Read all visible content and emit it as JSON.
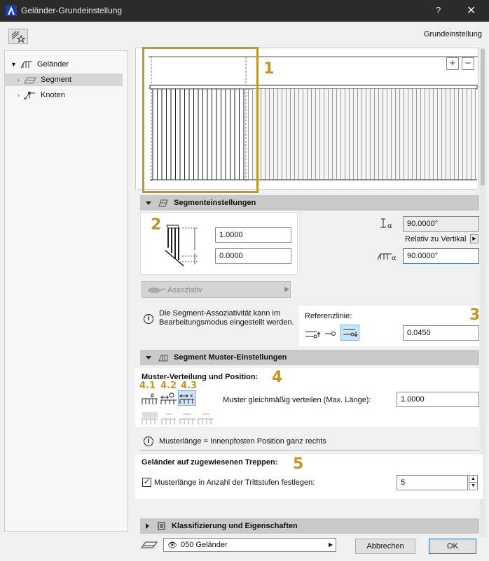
{
  "window": {
    "title": "Geländer-Grundeinstellung",
    "help": "?",
    "close": "✕"
  },
  "header": {
    "title": "Grundeinstellung"
  },
  "tree": {
    "items": [
      {
        "label": "Geländer"
      },
      {
        "label": "Segment"
      },
      {
        "label": "Knoten"
      }
    ]
  },
  "preview": {
    "zoom_in": "+",
    "zoom_out": "−"
  },
  "markers": {
    "m1": "1",
    "m2": "2",
    "m3": "3",
    "m4": "4",
    "m5": "5",
    "m41": "4.1",
    "m42": "4.2",
    "m43": "4.3"
  },
  "segment_settings": {
    "title": "Segmenteinstellungen",
    "height_value": "1.0000",
    "offset_value": "0.0000",
    "angle1_value": "90.0000°",
    "relative_label": "Relativ zu Vertikal",
    "angle2_value": "90.0000°",
    "assoc_label": "Assoziativ",
    "info_text": "Die Segment-Assoziativität kann im Bearbeitungsmodus eingestellt werden.",
    "reference_label": "Referenzlinie:",
    "reference_value": "0.0450"
  },
  "pattern_settings": {
    "title": "Segment Muster-Einstellungen",
    "dist_label": "Muster-Verteilung und Position:",
    "distribute_label": "Muster gleichmäßig verteilen (Max. Länge):",
    "distribute_value": "1.0000",
    "info_text": "Musterlänge = Innenpfosten Position ganz rechts"
  },
  "stairs": {
    "title": "Geländer auf zugewiesenen Treppen:",
    "checkbox_label": "Musterlänge in Anzahl der Trittstufen festlegen:",
    "checked": true,
    "value": "5"
  },
  "classification": {
    "title": "Klassifizierung und Eigenschaften"
  },
  "footer": {
    "layer_value": "050 Geländer",
    "cancel": "Abbrechen",
    "ok": "OK"
  },
  "colors": {
    "accent": "#c2962b",
    "focus": "#2c6db0",
    "titlebar": "#2b2b2b"
  }
}
